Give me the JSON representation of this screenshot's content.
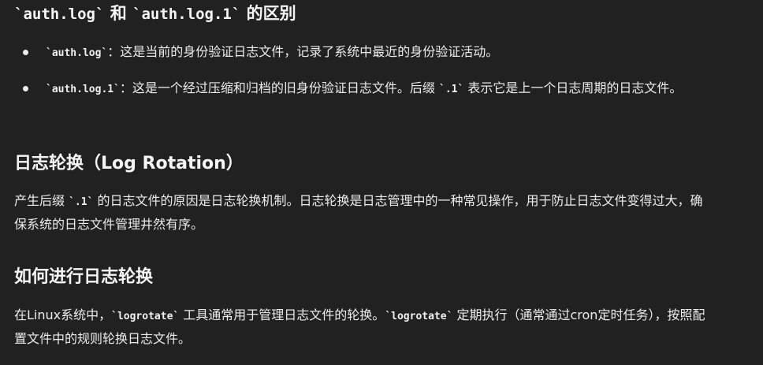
{
  "section1": {
    "heading_pre": "`auth.log`",
    "heading_mid": " 和 ",
    "heading_code2": "`auth.log.1`",
    "heading_post": " 的区别",
    "items": [
      {
        "code": "`auth.log`",
        "text": "：这是当前的身份验证日志文件，记录了系统中最近的身份验证活动。"
      },
      {
        "code": "`auth.log.1`",
        "text_a": "：这是一个经过压缩和归档的旧身份验证日志文件。后缀 ",
        "code2": "`.1`",
        "text_b": " 表示它是上一个日志周期的日志文件。"
      }
    ]
  },
  "section2": {
    "heading": "日志轮换（Log Rotation）",
    "para_a": "产生后缀 ",
    "para_code": "`.1`",
    "para_b": " 的日志文件的原因是日志轮换机制。日志轮换是日志管理中的一种常见操作，用于防止日志文件变得过大，确保系统的日志文件管理井然有序。"
  },
  "section3": {
    "heading": "如何进行日志轮换",
    "para_a": "在Linux系统中，",
    "para_code1": "`logrotate`",
    "para_b": " 工具通常用于管理日志文件的轮换。",
    "para_code2": "`logrotate`",
    "para_c": " 定期执行（通常通过cron定时任务），按照配置文件中的规则轮换日志文件。"
  }
}
